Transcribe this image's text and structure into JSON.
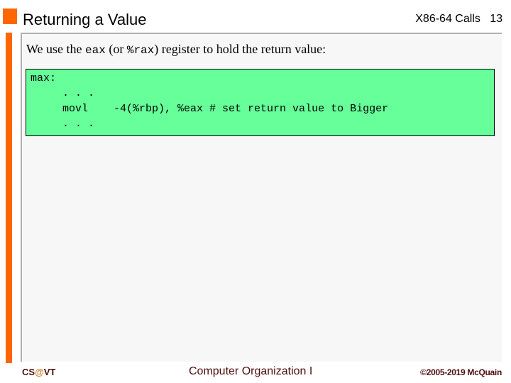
{
  "header": {
    "title": "Returning a Value",
    "section": "X86-64 Calls",
    "page_number": "13"
  },
  "content": {
    "intro": {
      "part1": "We use the ",
      "reg1": "eax",
      "part2": " (or ",
      "reg2": "%rax",
      "part3": ") register to hold the return value:"
    },
    "code_lines": [
      "max:",
      "     . . .",
      "     movl    -4(%rbp), %eax # set return value to Bigger",
      "     . . ."
    ]
  },
  "footer": {
    "left_prefix": "CS",
    "left_at": "@",
    "left_suffix": "VT",
    "center": "Computer Organization I",
    "right": "©2005-2019 McQuain"
  },
  "colors": {
    "accent": "#ff6600",
    "code_background": "#66ff99",
    "footer_text": "#4d0d0d"
  }
}
